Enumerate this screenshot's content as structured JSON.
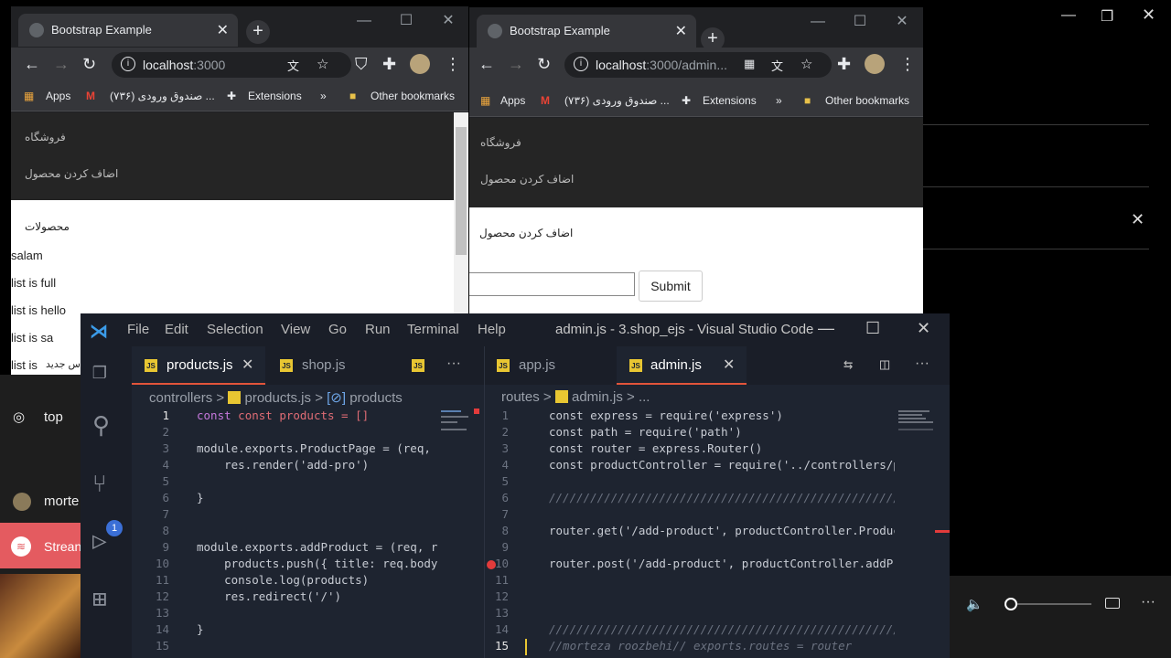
{
  "desktop": {
    "left_items": [
      {
        "icon": "camera-icon",
        "label": "top"
      },
      {
        "icon": "avatar",
        "label": "morte"
      }
    ],
    "spotify_label": "Strean"
  },
  "chrome1": {
    "tab_title": "Bootstrap Example",
    "url_host": "localhost",
    "url_rest": ":3000",
    "bookmarks": {
      "apps": "Apps",
      "gmail": "(۷۳۶) صندوق ورودی ...",
      "extensions": "Extensions",
      "more": "»",
      "other": "Other bookmarks"
    },
    "nav": {
      "shop": "فروشگاه",
      "add_product": "اضاف کردن محصول"
    },
    "heading": "محصولات",
    "items": [
      "salam",
      "list is full",
      "list is hello",
      "list is sa",
      "list is"
    ],
    "overlap_text": "س جدید"
  },
  "chrome2": {
    "tab_title": "Bootstrap Example",
    "url_host": "localhost",
    "url_rest": ":3000/admin...",
    "bookmarks": {
      "apps": "Apps",
      "gmail": "(۷۳۶) صندوق ورودی ...",
      "extensions": "Extensions",
      "more": "»",
      "other": "Other bookmarks"
    },
    "nav": {
      "shop": "فروشگاه",
      "add_product": "اضاف کردن محصول"
    },
    "form_title": "اضاف کردن محصول",
    "submit_label": "Submit"
  },
  "vscode": {
    "menu": [
      "File",
      "Edit",
      "Selection",
      "View",
      "Go",
      "Run",
      "Terminal",
      "Help"
    ],
    "title": "admin.js - 3.shop_ejs - Visual Studio Code",
    "scm_badge": "1",
    "left_group": {
      "tabs": [
        {
          "label": "products.js",
          "active": true
        },
        {
          "label": "shop.js",
          "active": false
        }
      ],
      "more": "···",
      "breadcrumb": {
        "folder": "controllers",
        "sep": ">",
        "file": "products.js",
        "symbol": "products"
      },
      "lines": [
        {
          "n": "1"
        },
        {
          "n": "2"
        },
        {
          "n": "3"
        },
        {
          "n": "4"
        },
        {
          "n": "5"
        },
        {
          "n": "6"
        },
        {
          "n": "7"
        },
        {
          "n": "8"
        },
        {
          "n": "9"
        },
        {
          "n": "10"
        },
        {
          "n": "11"
        },
        {
          "n": "12"
        },
        {
          "n": "13"
        },
        {
          "n": "14"
        },
        {
          "n": "15"
        }
      ],
      "code": {
        "l1": "const products = []",
        "l3": "module.exports.ProductPage = (req, re",
        "l4": "    res.render('add-pro')",
        "l6": "}",
        "l9": "module.exports.addProduct = (req, res",
        "l10": "    products.push({ title: req.body.",
        "l11": "    console.log(products)",
        "l12": "    res.redirect('/')",
        "l14": "}"
      }
    },
    "right_group": {
      "tabs": [
        {
          "label": "app.js",
          "active": false
        },
        {
          "label": "admin.js",
          "active": true
        }
      ],
      "more": "···",
      "breadcrumb": {
        "folder": "routes",
        "sep": ">",
        "file": "admin.js",
        "symbol": "..."
      },
      "code": {
        "l1": "const express = require('express')",
        "l2": "const path = require('path')",
        "l3": "const router = express.Router()",
        "l4": "const productController = require('../controllers/pr",
        "l6": "//////////////////////////////////////////////////////",
        "l8": "router.get('/add-product', productController.Product",
        "l10": "router.post('/add-product', productController.addPro",
        "l14": "//////////////////////////////////////////////////////",
        "l15": "//morteza roozbehi// exports.routes = router"
      }
    }
  },
  "colors": {
    "accent": "#e2543a",
    "badge": "#3b6fd6",
    "breakpoint": "#e23b3b"
  }
}
